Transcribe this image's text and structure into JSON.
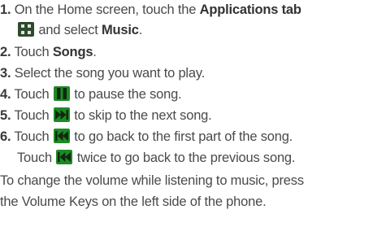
{
  "steps": [
    {
      "num": "1.",
      "t1": " On the Home screen, touch the ",
      "b1": "Applications tab",
      "t2": "and select ",
      "b2": "Music",
      "t3": "."
    },
    {
      "num": "2.",
      "t1": " Touch ",
      "b1": "Songs",
      "t2": "."
    },
    {
      "num": "3.",
      "t1": " Select the song you want to play."
    },
    {
      "num": "4.",
      "t1": " Touch ",
      "t2": " to pause the song."
    },
    {
      "num": "5.",
      "t1": " Touch ",
      "t2": " to skip to the next song."
    },
    {
      "num": "6.",
      "t1": " Touch ",
      "t2": " to go back to the first part of the song.",
      "t3": "Touch ",
      "t4": " twice to go back to the previous song."
    }
  ],
  "note": {
    "line1": "To change the volume while listening to music, press",
    "line2": "the Volume Keys on the left side of the phone."
  },
  "icons": {
    "apps": "applications-tab-icon",
    "pause": "pause-icon",
    "next": "next-track-icon",
    "prev": "previous-track-icon"
  },
  "colors": {
    "text": "#4a4a4a",
    "icon_dark": "#2e5a2c",
    "icon_fill": "#1e8a24"
  }
}
